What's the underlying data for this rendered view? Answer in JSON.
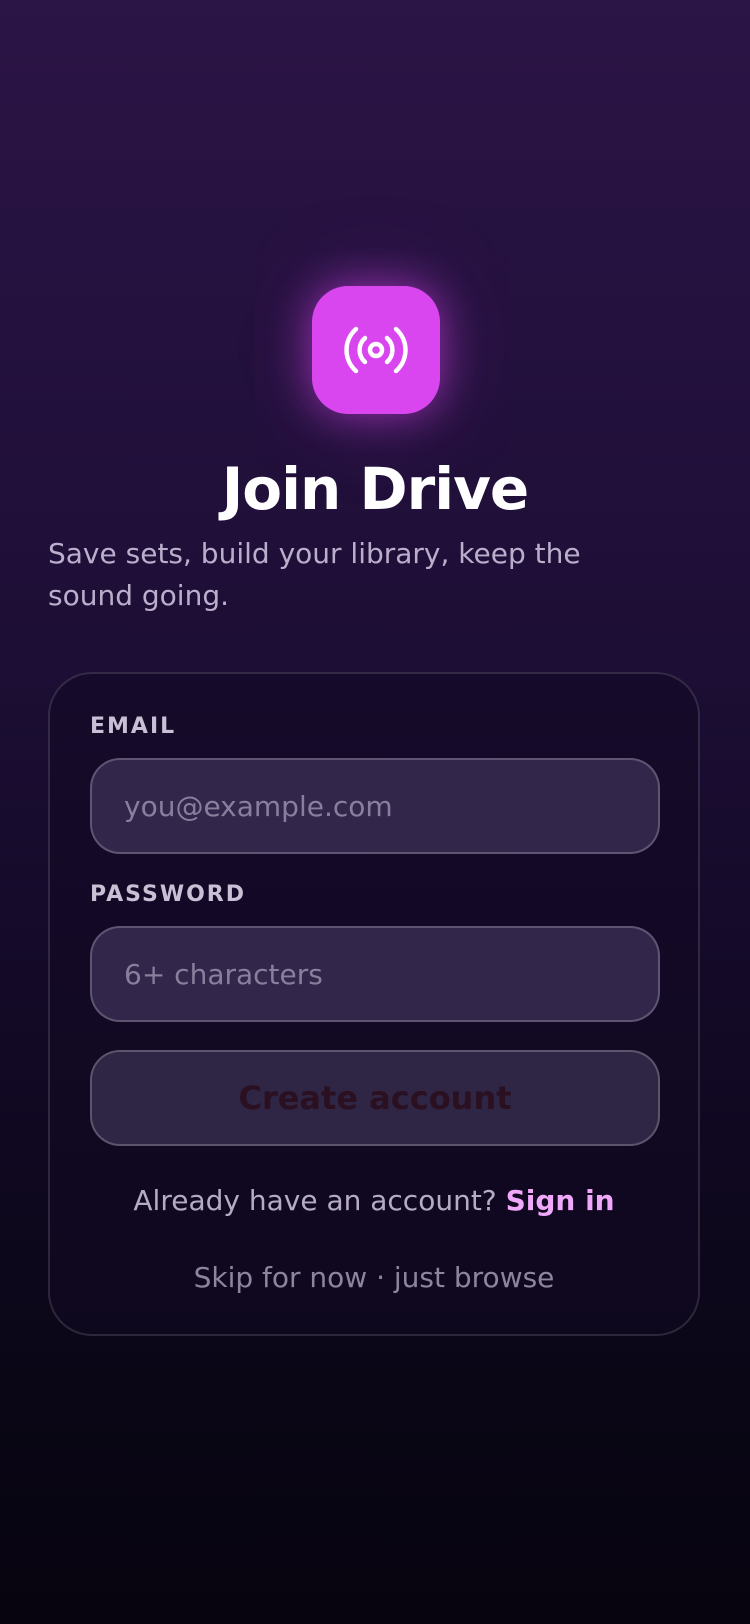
{
  "app_icon": {
    "name": "broadcast-icon",
    "color": "#d946ef"
  },
  "header": {
    "title": "Join Drive",
    "subtitle": "Save sets, build your library, keep the sound going."
  },
  "form": {
    "email": {
      "label": "EMAIL",
      "placeholder": "you@example.com",
      "value": ""
    },
    "password": {
      "label": "PASSWORD",
      "placeholder": "6+ characters",
      "value": ""
    },
    "submit_label": "Create account",
    "signin_prompt": "Already have an account?",
    "signin_link": "Sign in",
    "skip_label": "Skip for now · just browse"
  }
}
